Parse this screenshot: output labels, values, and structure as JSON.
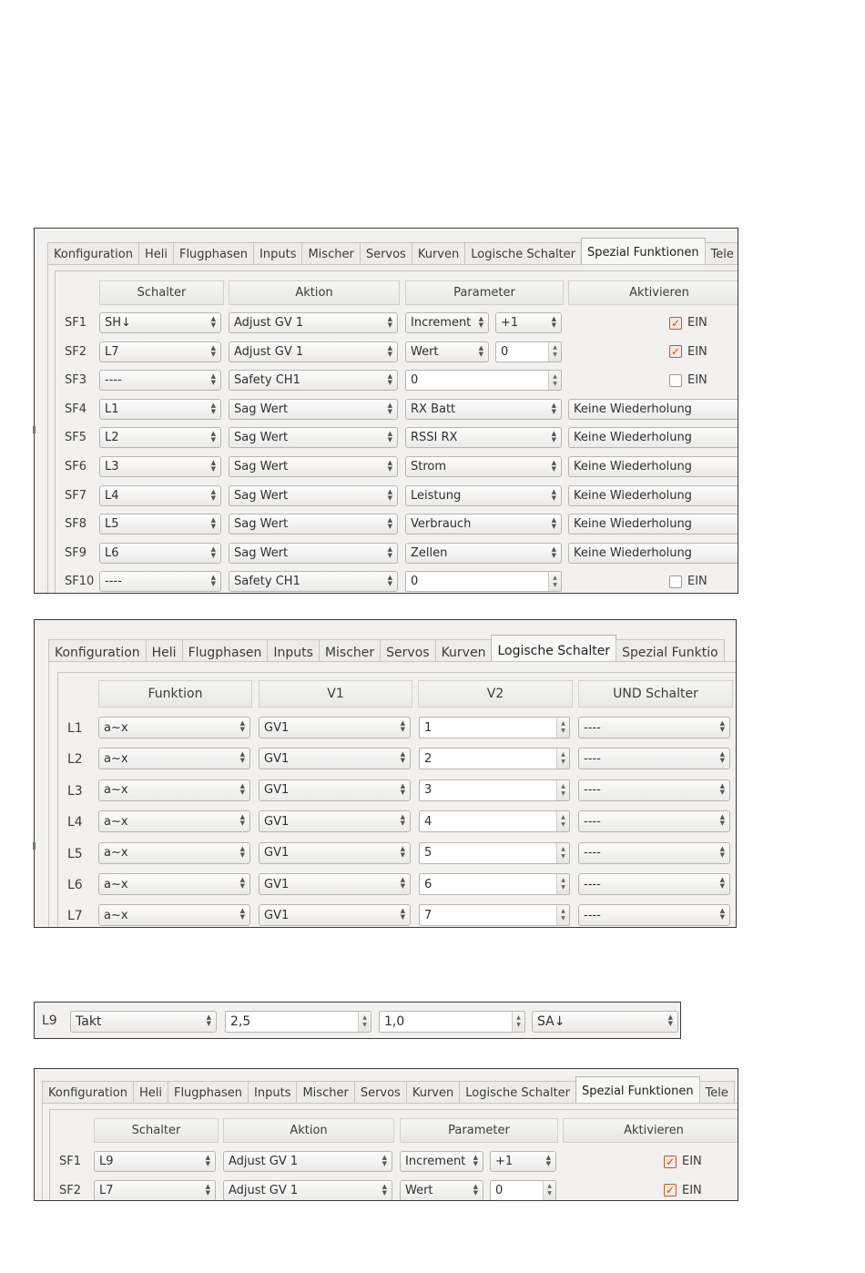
{
  "tabs_sf": [
    "Konfiguration",
    "Heli",
    "Flugphasen",
    "Inputs",
    "Mischer",
    "Servos",
    "Kurven",
    "Logische Schalter",
    "Spezial Funktionen",
    "Tele"
  ],
  "tabs_ls": [
    "Konfiguration",
    "Heli",
    "Flugphasen",
    "Inputs",
    "Mischer",
    "Servos",
    "Kurven",
    "Logische Schalter",
    "Spezial Funktio"
  ],
  "sf_headers": {
    "schalter": "Schalter",
    "aktion": "Aktion",
    "parameter": "Parameter",
    "aktivieren": "Aktivieren"
  },
  "ls_headers": {
    "funktion": "Funktion",
    "v1": "V1",
    "v2": "V2",
    "und": "UND Schalter"
  },
  "ein_label": "EIN",
  "sf_rows": [
    {
      "label": "SF1",
      "schalter": "SH↓",
      "aktion": "Adjust GV 1",
      "param": "Increment",
      "value": "+1",
      "kind": "combo2",
      "aktiv": true
    },
    {
      "label": "SF2",
      "schalter": "L7",
      "aktion": "Adjust GV 1",
      "param": "Wert",
      "value": "0",
      "kind": "spin2",
      "aktiv": true
    },
    {
      "label": "SF3",
      "schalter": "----",
      "aktion": "Safety CH1",
      "param": "0",
      "kind": "spinwide",
      "aktiv": false
    },
    {
      "label": "SF4",
      "schalter": "L1",
      "aktion": "Sag Wert",
      "param": "RX Batt",
      "kind": "repeat",
      "repeat": "Keine Wiederholung"
    },
    {
      "label": "SF5",
      "schalter": "L2",
      "aktion": "Sag Wert",
      "param": "RSSI RX",
      "kind": "repeat",
      "repeat": "Keine Wiederholung"
    },
    {
      "label": "SF6",
      "schalter": "L3",
      "aktion": "Sag Wert",
      "param": "Strom",
      "kind": "repeat",
      "repeat": "Keine Wiederholung"
    },
    {
      "label": "SF7",
      "schalter": "L4",
      "aktion": "Sag Wert",
      "param": "Leistung",
      "kind": "repeat",
      "repeat": "Keine Wiederholung"
    },
    {
      "label": "SF8",
      "schalter": "L5",
      "aktion": "Sag Wert",
      "param": "Verbrauch",
      "kind": "repeat",
      "repeat": "Keine Wiederholung"
    },
    {
      "label": "SF9",
      "schalter": "L6",
      "aktion": "Sag Wert",
      "param": "Zellen",
      "kind": "repeat",
      "repeat": "Keine Wiederholung"
    },
    {
      "label": "SF10",
      "schalter": "----",
      "aktion": "Safety CH1",
      "param": "0",
      "kind": "spinwide",
      "aktiv": false
    }
  ],
  "ls_rows": [
    {
      "label": "L1",
      "funktion": "a~x",
      "v1": "GV1",
      "v2": "1",
      "und": "----"
    },
    {
      "label": "L2",
      "funktion": "a~x",
      "v1": "GV1",
      "v2": "2",
      "und": "----"
    },
    {
      "label": "L3",
      "funktion": "a~x",
      "v1": "GV1",
      "v2": "3",
      "und": "----"
    },
    {
      "label": "L4",
      "funktion": "a~x",
      "v1": "GV1",
      "v2": "4",
      "und": "----"
    },
    {
      "label": "L5",
      "funktion": "a~x",
      "v1": "GV1",
      "v2": "5",
      "und": "----"
    },
    {
      "label": "L6",
      "funktion": "a~x",
      "v1": "GV1",
      "v2": "6",
      "und": "----"
    },
    {
      "label": "L7",
      "funktion": "a~x",
      "v1": "GV1",
      "v2": "7",
      "und": "----"
    }
  ],
  "l9": {
    "label": "L9",
    "funktion": "Takt",
    "v1": "2,5",
    "v2": "1,0",
    "und": "SA↓"
  },
  "sf_rows_2": [
    {
      "label": "SF1",
      "schalter": "L9",
      "aktion": "Adjust GV 1",
      "param": "Increment",
      "value": "+1",
      "kind": "combo2",
      "aktiv": true
    },
    {
      "label": "SF2",
      "schalter": "L7",
      "aktion": "Adjust GV 1",
      "param": "Wert",
      "value": "0",
      "kind": "spin2",
      "aktiv": true
    }
  ]
}
